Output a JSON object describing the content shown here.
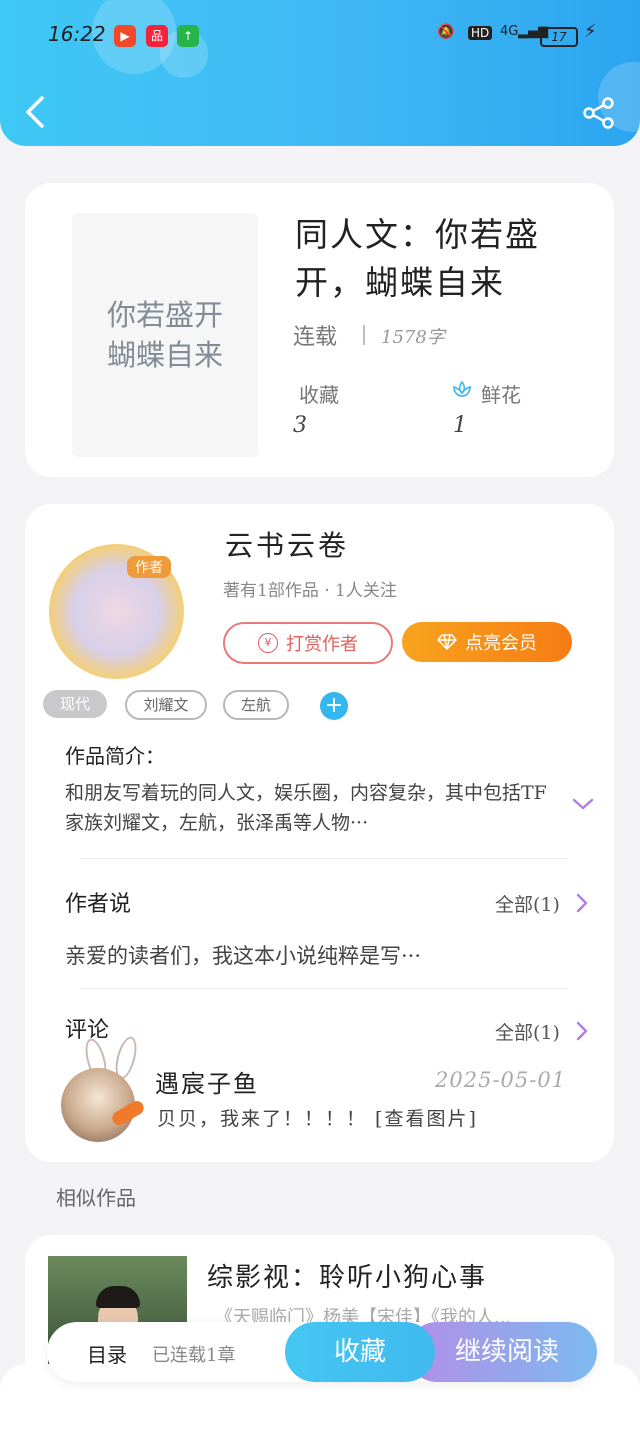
{
  "status_bar": {
    "time": "16:22",
    "apps": [
      {
        "name": "video-app-icon",
        "color": "#f04a2b",
        "glyph": "▶"
      },
      {
        "name": "shopping-app-icon",
        "color": "#f2233b",
        "glyph": "品"
      },
      {
        "name": "upload-app-icon",
        "color": "#25b34a",
        "glyph": "↑"
      }
    ],
    "network": "HD",
    "signal": "4G",
    "battery": "17"
  },
  "colors": {
    "accent": "#41b8f4",
    "vip_orange": "#f57c13",
    "tip_red": "#e06060",
    "chevron_purple": "#b27fe0"
  },
  "book": {
    "cover_text": "你若盛开\n蝴蝶自来",
    "title": "同人文：你若盛开，蝴蝶自来",
    "status": "连载",
    "word_count": "1578字",
    "stats": [
      {
        "label": "收藏",
        "value": "3"
      },
      {
        "label": "鲜花",
        "value": "1"
      }
    ]
  },
  "author": {
    "avatar_tag": "作者",
    "name": "云书云卷",
    "meta": "著有1部作品 · 1人关注",
    "tip_label": "打赏作者",
    "vip_label": "点亮会员"
  },
  "tags": [
    "现代",
    "刘耀文",
    "左航"
  ],
  "intro": {
    "heading": "作品简介：",
    "text": "和朋友写着玩的同人文，娱乐圈，内容复杂，其中包括TF家族刘耀文，左航，张泽禹等人物···"
  },
  "author_say": {
    "heading": "作者说",
    "all_label": "全部(1)",
    "text": "亲爱的读者们，我这本小说纯粹是写···"
  },
  "comments": {
    "heading": "评论",
    "all_label": "全部(1)",
    "items": [
      {
        "user": "遇宸子鱼",
        "date": "2025-05-01",
        "text": "贝贝，我来了！！！！ [查看图片]"
      }
    ]
  },
  "similar": {
    "heading": "相似作品",
    "items": [
      {
        "title": "综影视：聆听小狗心事",
        "desc": "《天赐临门》杨美【宋佳】《我的人..."
      }
    ]
  },
  "bottom_bar": {
    "toc_label": "目录",
    "serial_label": "已连载1章",
    "collect_label": "收藏",
    "read_label": "继续阅读"
  }
}
